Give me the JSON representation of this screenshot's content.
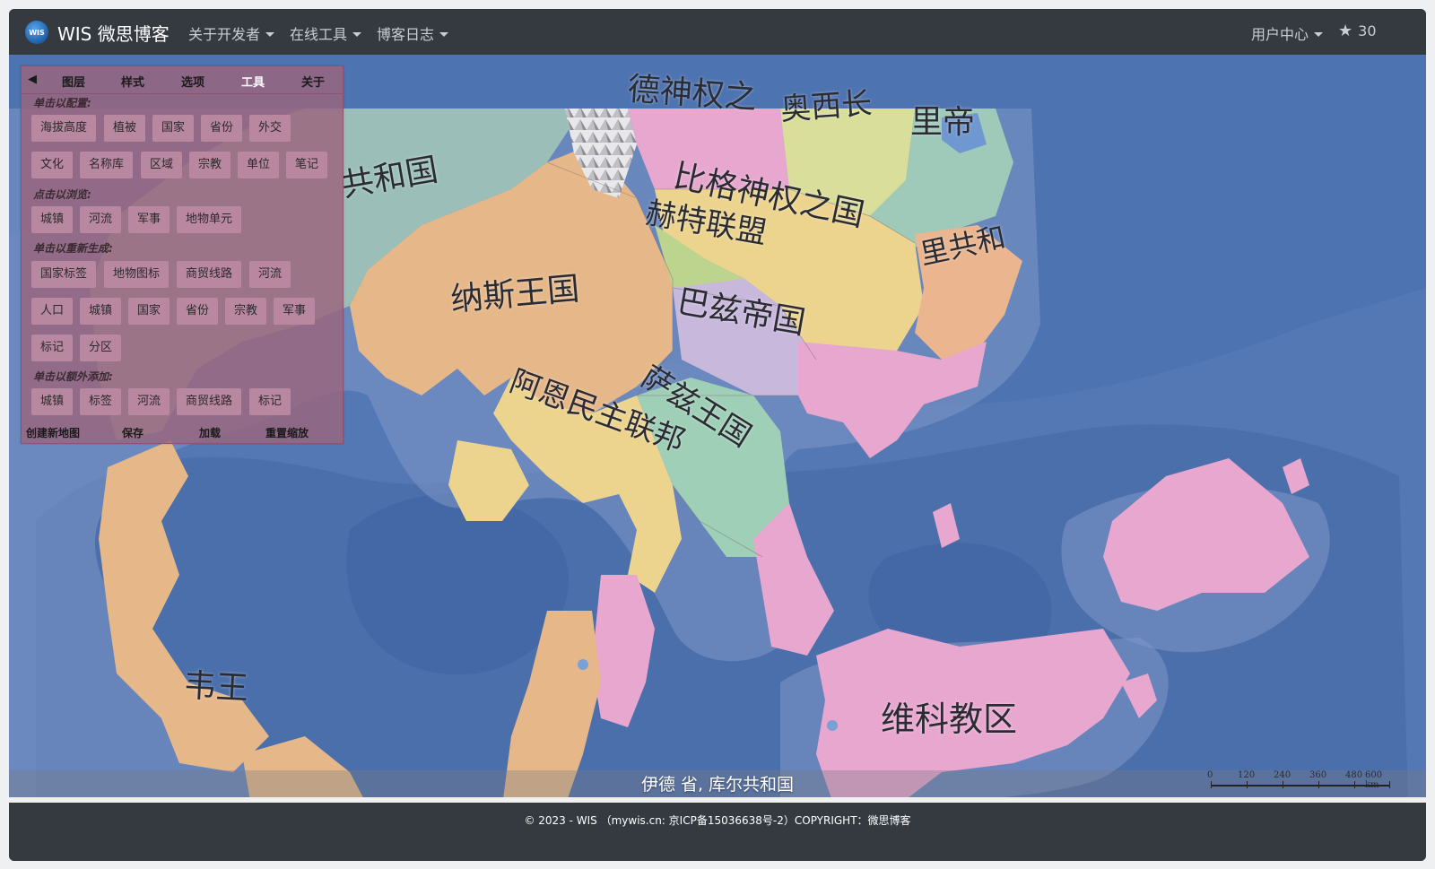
{
  "navbar": {
    "brand_logo": "WIS",
    "brand_title": "WIS 微思博客",
    "menu": [
      "关于开发者",
      "在线工具",
      "博客日志"
    ],
    "user_center": "用户中心",
    "star_count": "30"
  },
  "panel": {
    "collapse": "◀",
    "tabs": [
      "图层",
      "样式",
      "选项",
      "工具",
      "关于"
    ],
    "active_tab": "工具",
    "sections": {
      "configure": {
        "title": "单击以配置:",
        "row1": [
          "海拔高度",
          "植被",
          "国家",
          "省份",
          "外交"
        ],
        "row2": [
          "文化",
          "名称库",
          "区域",
          "宗教",
          "单位",
          "笔记"
        ]
      },
      "browse": {
        "title": "点击以浏览:",
        "row1": [
          "城镇",
          "河流",
          "军事",
          "地物单元"
        ]
      },
      "regenerate": {
        "title": "单击以重新生成:",
        "row1": [
          "国家标签",
          "地物图标",
          "商贸线路",
          "河流"
        ],
        "row2": [
          "人口",
          "城镇",
          "国家",
          "省份",
          "宗教",
          "军事"
        ],
        "row3": [
          "标记",
          "分区"
        ]
      },
      "add": {
        "title": "单击以额外添加:",
        "row1": [
          "城镇",
          "标签",
          "河流",
          "商贸线路",
          "标记"
        ]
      }
    },
    "bottom": [
      "创建新地图",
      "保存",
      "加载",
      "重置缩放"
    ]
  },
  "map": {
    "labels": [
      "德神权之",
      "奥西长",
      "里帝",
      "共和国",
      "比格神权之国",
      "赫特联盟",
      "里共和",
      "纳斯王国",
      "巴兹帝国",
      "阿恩民主联邦",
      "萨兹王国",
      "韦王",
      "维科教区"
    ],
    "province": "伊德 省, 库尔共和国",
    "scale_ticks": [
      "0",
      "120",
      "240",
      "360",
      "480",
      "600 km"
    ]
  },
  "footer": {
    "text": "© 2023 - WIS （mywis.cn: 京ICP备15036638号-2）COPYRIGHT：微思博客"
  },
  "colors": {
    "navbar": "#343a40",
    "ocean": "#4d73b0",
    "panel": "#9b647d"
  }
}
